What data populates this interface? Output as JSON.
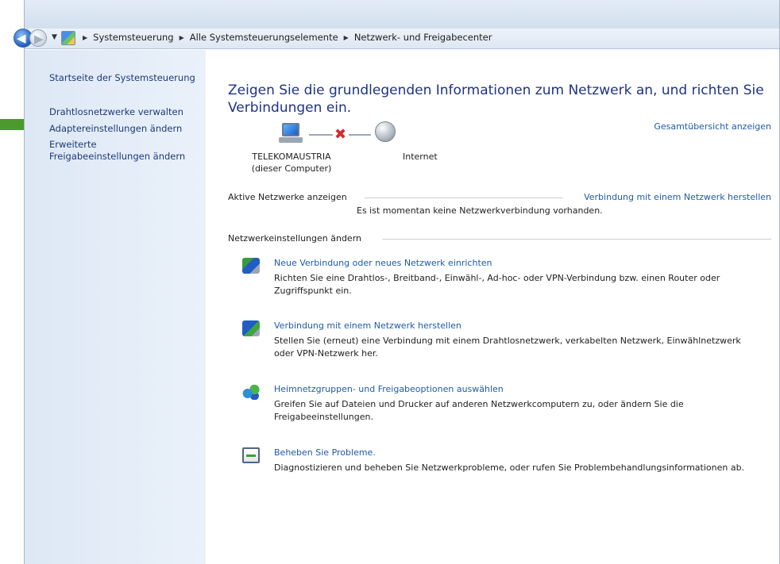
{
  "address": {
    "crumbs": [
      "Systemsteuerung",
      "Alle Systemsteuerungselemente",
      "Netzwerk- und Freigabecenter"
    ],
    "separator": "▶",
    "back_arrow": "◀",
    "forward_arrow": "▶",
    "dropdown_glyph": "▼"
  },
  "sidebar": {
    "items": [
      {
        "label": "Startseite der Systemsteuerung"
      },
      {
        "label": "Drahtlosnetzwerke verwalten"
      },
      {
        "label": "Adaptereinstellungen ändern"
      },
      {
        "label_line1": "Erweiterte",
        "label_line2": "Freigabeeinstellungen ändern"
      }
    ],
    "highlight_color": "#4a9a2f"
  },
  "main": {
    "heading": "Zeigen Sie die grundlegenden Informationen zum Netzwerk an, und richten Sie Verbindungen ein.",
    "overview_link": "Gesamtübersicht anzeigen",
    "network_map": {
      "computer_name": "TELEKOMAUSTRIA",
      "computer_sub": "(dieser Computer)",
      "internet": "Internet",
      "link_status_glyph": "✖"
    },
    "active": {
      "heading": "Aktive Netzwerke anzeigen",
      "connect_link": "Verbindung mit einem Netzwerk herstellen",
      "message": "Es ist momentan keine Netzwerkverbindung vorhanden."
    },
    "settings": {
      "heading": "Netzwerkeinstellungen ändern",
      "tasks": [
        {
          "icon": "new-connection-icon",
          "link": "Neue Verbindung oder neues Netzwerk einrichten",
          "desc": "Richten Sie eine Drahtlos-, Breitband-, Einwähl-, Ad-hoc- oder VPN-Verbindung bzw. einen Router oder Zugriffspunkt ein."
        },
        {
          "icon": "connect-network-icon",
          "link": "Verbindung mit einem Netzwerk herstellen",
          "desc": "Stellen Sie (erneut) eine Verbindung mit einem Drahtlosnetzwerk, verkabelten Netzwerk, Einwählnetzwerk oder VPN-Netzwerk her."
        },
        {
          "icon": "homegroup-icon",
          "link": "Heimnetzgruppen- und Freigabeoptionen auswählen",
          "desc": "Greifen Sie auf Dateien und Drucker auf anderen Netzwerkcomputern zu, oder ändern Sie die Freigabeeinstellungen."
        },
        {
          "icon": "troubleshoot-icon",
          "link": "Beheben Sie Probleme.",
          "desc": "Diagnostizieren und beheben Sie Netzwerkprobleme, oder rufen Sie Problembehandlungsinformationen ab."
        }
      ]
    }
  }
}
